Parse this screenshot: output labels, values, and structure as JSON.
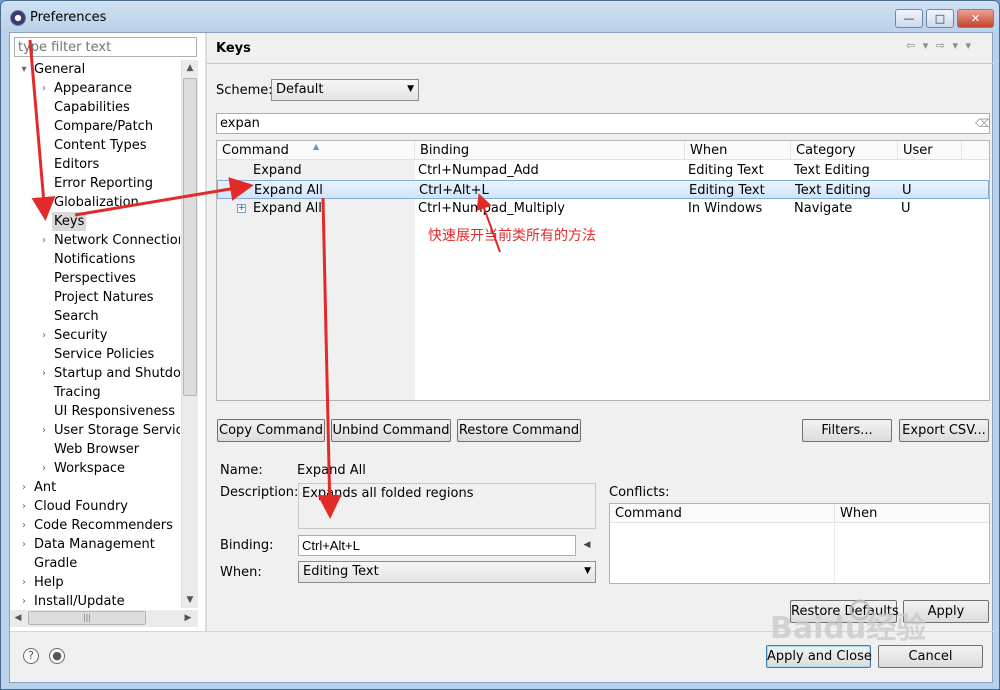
{
  "window": {
    "title": "Preferences",
    "min_glyph": "—",
    "max_glyph": "□",
    "close_glyph": "✕"
  },
  "left": {
    "filter_placeholder": "type filter text",
    "tree": [
      {
        "label": "General",
        "level": 0,
        "expanded": true
      },
      {
        "label": "Appearance",
        "level": 1,
        "twisty": true
      },
      {
        "label": "Capabilities",
        "level": 1
      },
      {
        "label": "Compare/Patch",
        "level": 1
      },
      {
        "label": "Content Types",
        "level": 1
      },
      {
        "label": "Editors",
        "level": 1
      },
      {
        "label": "Error Reporting",
        "level": 1
      },
      {
        "label": "Globalization",
        "level": 1
      },
      {
        "label": "Keys",
        "level": 1,
        "selected": true
      },
      {
        "label": "Network Connections",
        "level": 1,
        "twisty": true
      },
      {
        "label": "Notifications",
        "level": 1
      },
      {
        "label": "Perspectives",
        "level": 1
      },
      {
        "label": "Project Natures",
        "level": 1
      },
      {
        "label": "Search",
        "level": 1
      },
      {
        "label": "Security",
        "level": 1,
        "twisty": true
      },
      {
        "label": "Service Policies",
        "level": 1
      },
      {
        "label": "Startup and Shutdown",
        "level": 1,
        "twisty": true
      },
      {
        "label": "Tracing",
        "level": 1
      },
      {
        "label": "UI Responsiveness Monitoring",
        "level": 1
      },
      {
        "label": "User Storage Service",
        "level": 1,
        "twisty": true
      },
      {
        "label": "Web Browser",
        "level": 1
      },
      {
        "label": "Workspace",
        "level": 1,
        "twisty": true
      },
      {
        "label": "Ant",
        "level": 0,
        "twisty": true
      },
      {
        "label": "Cloud Foundry",
        "level": 0,
        "twisty": true
      },
      {
        "label": "Code Recommenders",
        "level": 0,
        "twisty": true
      },
      {
        "label": "Data Management",
        "level": 0,
        "twisty": true
      },
      {
        "label": "Gradle",
        "level": 0
      },
      {
        "label": "Help",
        "level": 0,
        "twisty": true
      },
      {
        "label": "Install/Update",
        "level": 0,
        "twisty": true
      }
    ]
  },
  "main": {
    "page_title": "Keys",
    "nav_arrows": "⇦ ▾ ⇨ ▾ ▾",
    "scheme_label": "Scheme:",
    "scheme_value": "Default",
    "filter_value": "expan",
    "table": {
      "columns": [
        "Command",
        "Binding",
        "When",
        "Category",
        "User"
      ],
      "rows": [
        {
          "command": "Expand",
          "binding": "Ctrl+Numpad_Add",
          "when": "Editing Text",
          "category": "Text Editing",
          "user": "",
          "expander": false,
          "selected": false
        },
        {
          "command": "Expand All",
          "binding": "Ctrl+Alt+L",
          "when": "Editing Text",
          "category": "Text Editing",
          "user": "U",
          "expander": false,
          "selected": true
        },
        {
          "command": "Expand All",
          "binding": "Ctrl+Numpad_Multiply",
          "when": "In Windows",
          "category": "Navigate",
          "user": "U",
          "expander": true,
          "selected": false
        }
      ]
    },
    "buttons": {
      "copy_command": "Copy Command",
      "unbind_command": "Unbind Command",
      "restore_command": "Restore Command",
      "filters": "Filters...",
      "export_csv": "Export CSV..."
    },
    "details": {
      "name_label": "Name:",
      "name_value": "Expand All",
      "description_label": "Description:",
      "description_value": "Expands all folded regions",
      "binding_label": "Binding:",
      "binding_value": "Ctrl+Alt+L",
      "when_label": "When:",
      "when_value": "Editing Text"
    },
    "conflicts": {
      "label": "Conflicts:",
      "columns": [
        "Command",
        "When"
      ]
    },
    "restore_defaults": "Restore Defaults",
    "apply": "Apply"
  },
  "footer": {
    "apply_and_close": "Apply and Close",
    "cancel": "Cancel"
  },
  "annotation": {
    "text": "快速展开当前类所有的方法",
    "color": "#e12b2b"
  },
  "watermark": {
    "text": "Baidu经验"
  }
}
